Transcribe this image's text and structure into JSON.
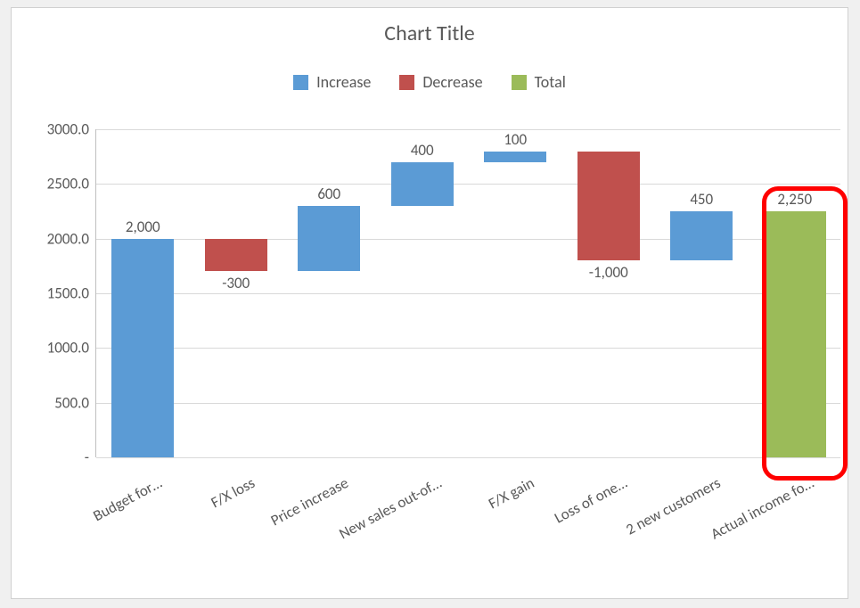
{
  "chart_data": {
    "type": "waterfall",
    "title": "Chart Title",
    "categories": [
      "Budget for…",
      "F/X loss",
      "Price increase",
      "New sales out-of…",
      "F/X gain",
      "Loss of one…",
      "2 new customers",
      "Actual income fo…"
    ],
    "values": [
      2000,
      -300,
      600,
      400,
      100,
      -1000,
      450,
      2250
    ],
    "data_labels": [
      "2,000",
      "-300",
      "600",
      "400",
      "100",
      "-1,000",
      "450",
      "2,250"
    ],
    "kinds": [
      "increase",
      "decrease",
      "increase",
      "increase",
      "increase",
      "decrease",
      "increase",
      "total"
    ],
    "colors": {
      "increase": "#5B9BD5",
      "decrease": "#C0504D",
      "total": "#9BBB59"
    },
    "legend": [
      {
        "label": "Increase",
        "color": "#5B9BD5"
      },
      {
        "label": "Decrease",
        "color": "#C0504D"
      },
      {
        "label": "Total",
        "color": "#9BBB59"
      }
    ],
    "ylim": [
      0,
      3000
    ],
    "yticks": [
      "-",
      "500.0",
      "1000.0",
      "1500.0",
      "2000.0",
      "2500.0",
      "3000.0"
    ],
    "highlight_index": 7
  }
}
